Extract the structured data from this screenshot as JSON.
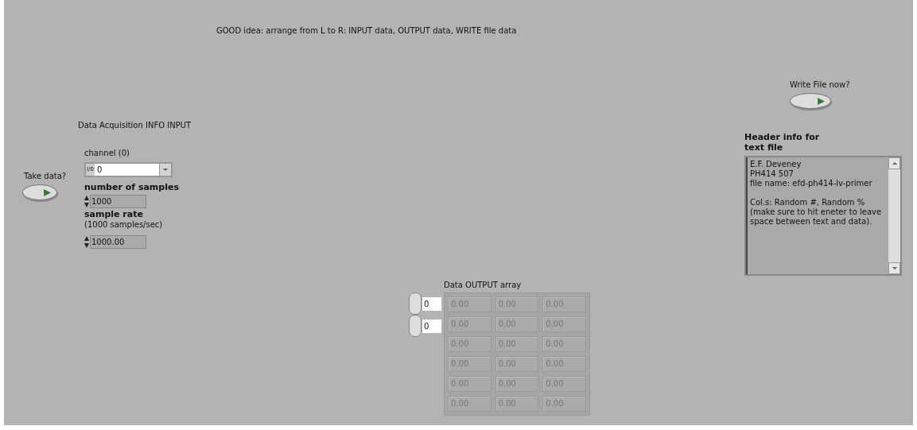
{
  "note": "GOOD idea:  arrange from L to R: INPUT data, OUTPUT data, WRITE file data",
  "input_section": {
    "title": "Data Acquisition INFO INPUT",
    "take_data": {
      "label": "Take data?",
      "on": false
    },
    "channel": {
      "label": "channel (0)",
      "value": "0",
      "prefix": "I/0"
    },
    "samples": {
      "label": "number of samples",
      "value": "1000"
    },
    "rate": {
      "label": "sample rate",
      "sublabel": "(1000 samples/sec)",
      "value": "1000.00"
    }
  },
  "output_array": {
    "label": "Data OUTPUT array",
    "indices": [
      "0",
      "0"
    ],
    "rows": [
      [
        "0.00",
        "0.00",
        "0.00"
      ],
      [
        "0.00",
        "0.00",
        "0.00"
      ],
      [
        "0.00",
        "0.00",
        "0.00"
      ],
      [
        "0.00",
        "0.00",
        "0.00"
      ],
      [
        "0.00",
        "0.00",
        "0.00"
      ],
      [
        "0.00",
        "0.00",
        "0.00"
      ]
    ]
  },
  "write_file": {
    "label": "Write File now?",
    "on": false
  },
  "header": {
    "label": "Header info for text file",
    "paragraphs": [
      [
        "E.F. Deveney",
        "PH414 507",
        "file name: efd-ph414-lv-primer"
      ],
      [
        "Col.s: Random #, Random %",
        "(make sure to hit eneter to leave space between text and data)."
      ]
    ]
  }
}
